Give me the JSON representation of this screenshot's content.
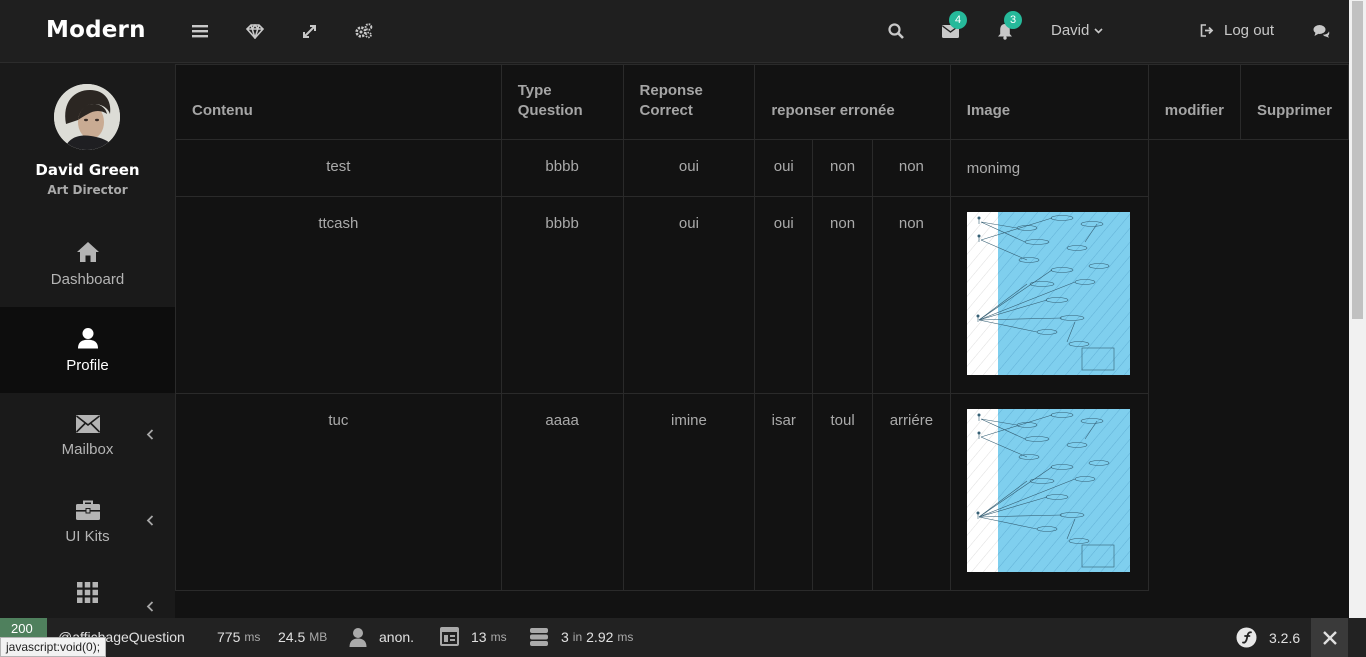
{
  "header": {
    "brand": "Modern",
    "messages_count": "4",
    "notifications_count": "3",
    "user_name": "David",
    "logout_label": "Log out"
  },
  "sidebar": {
    "profile_name": "David Green",
    "profile_role": "Art Director",
    "items": [
      {
        "label": "Dashboard",
        "icon": "home-icon"
      },
      {
        "label": "Profile",
        "icon": "user-icon"
      },
      {
        "label": "Mailbox",
        "icon": "envelope-icon"
      },
      {
        "label": "UI Kits",
        "icon": "briefcase-icon"
      },
      {
        "label": "",
        "icon": "grid-icon"
      }
    ]
  },
  "table": {
    "headers": {
      "contenu": "Contenu",
      "type": "Type Question",
      "reponse": "Reponse Correct",
      "erronee": "reponser erronée",
      "image": "Image",
      "modifier": "modifier",
      "supprimer": "Supprimer"
    },
    "rows": [
      {
        "contenu": "test",
        "type": "bbbb",
        "reponse": "oui",
        "wrong": [
          "oui",
          "non",
          "non"
        ],
        "image": "monimg"
      },
      {
        "contenu": "ttcash",
        "type": "bbbb",
        "reponse": "oui",
        "wrong": [
          "oui",
          "non",
          "non"
        ],
        "image": ""
      },
      {
        "contenu": "tuc",
        "type": "aaaa",
        "reponse": "imine",
        "wrong": [
          "isar",
          "toul",
          "arriére"
        ],
        "image": ""
      }
    ]
  },
  "debugbar": {
    "status": "200",
    "route": "@affichageQuestion",
    "time_value": "775",
    "time_unit": "ms",
    "memory_value": "24.5",
    "memory_unit": "MB",
    "user": "anon.",
    "render_value": "13",
    "render_unit": "ms",
    "db_queries": "3",
    "db_in": "in",
    "db_time": "2.92",
    "db_unit": "ms",
    "version": "3.2.6"
  },
  "tooltip": "javascript:void(0);",
  "colors": {
    "accent": "#26b99a",
    "status_ok": "#4f805d",
    "diagram_bg": "#7fcfee"
  }
}
